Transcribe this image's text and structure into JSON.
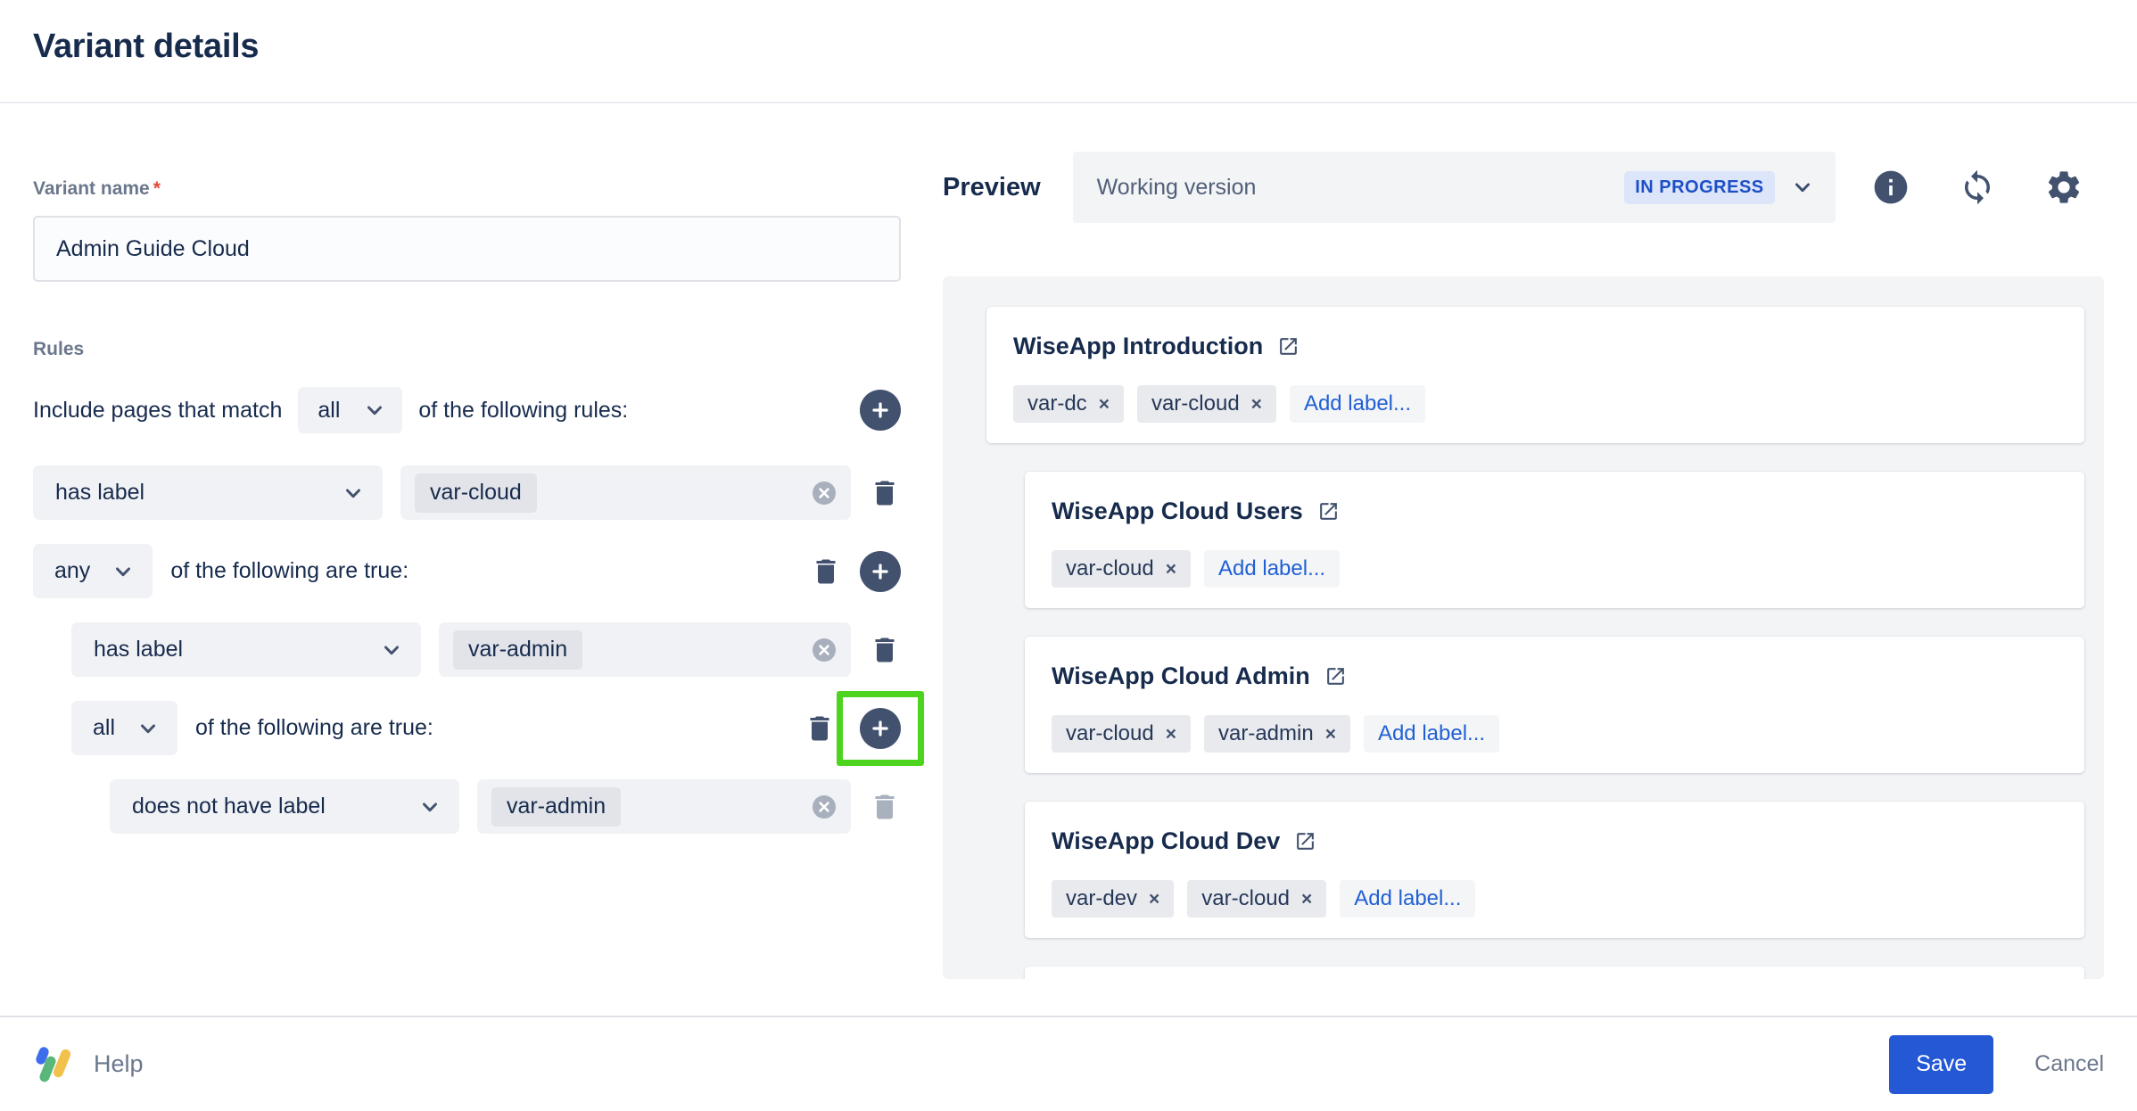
{
  "header": {
    "title": "Variant details"
  },
  "form": {
    "variant_name": {
      "label": "Variant name",
      "required_mark": "*",
      "value": "Admin Guide Cloud"
    },
    "rules": {
      "label": "Rules",
      "match": {
        "prefix": "Include pages that match",
        "operator": "all",
        "suffix": "of the following rules:"
      },
      "rows": [
        {
          "type": "condition",
          "operator": "has label",
          "value": "var-cloud",
          "delete_disabled": false
        },
        {
          "type": "group",
          "operator": "any",
          "suffix": "of the following are true:"
        },
        {
          "type": "condition",
          "operator": "has label",
          "value": "var-admin",
          "delete_disabled": false
        },
        {
          "type": "group",
          "operator": "all",
          "suffix": "of the following are true:",
          "highlighted": true
        },
        {
          "type": "condition",
          "operator": "does not have label",
          "value": "var-admin",
          "delete_disabled": true
        }
      ]
    }
  },
  "preview": {
    "label": "Preview",
    "version": {
      "name": "Working version",
      "status": "IN PROGRESS"
    },
    "pages": [
      {
        "title": "WiseApp Introduction",
        "labels": [
          "var-dc",
          "var-cloud"
        ],
        "add_label": "Add label...",
        "nested": false
      },
      {
        "title": "WiseApp Cloud Users",
        "labels": [
          "var-cloud"
        ],
        "add_label": "Add label...",
        "nested": true
      },
      {
        "title": "WiseApp Cloud Admin",
        "labels": [
          "var-cloud",
          "var-admin"
        ],
        "add_label": "Add label...",
        "nested": true
      },
      {
        "title": "WiseApp Cloud Dev",
        "labels": [
          "var-dev",
          "var-cloud"
        ],
        "add_label": "Add label...",
        "nested": true
      }
    ]
  },
  "footer": {
    "help": "Help",
    "save": "Save",
    "cancel": "Cancel"
  },
  "icons": {
    "close_x": "×",
    "names": [
      "chevron-down-icon",
      "plus-circle-icon",
      "trash-icon",
      "clear-circle-icon",
      "info-icon",
      "refresh-icon",
      "gear-icon",
      "external-link-icon",
      "k15t-logo"
    ]
  },
  "colors": {
    "accent_blue": "#2458D4",
    "link_blue": "#2160D4",
    "status_badge_bg": "#DCE5FA",
    "status_badge_text": "#1D4FC4",
    "highlight_green": "#4CD41E",
    "icon_slate": "#42526E",
    "field_bg": "#F1F2F5",
    "panel_bg": "#F3F4F6",
    "required_red": "#E34935"
  }
}
